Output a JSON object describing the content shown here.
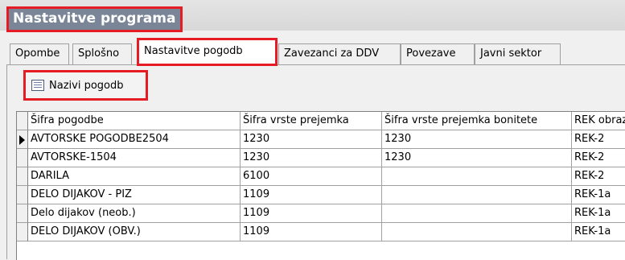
{
  "window": {
    "title": "Nastavitve programa"
  },
  "tabs": [
    {
      "label": "Opombe"
    },
    {
      "label": "Splošno"
    },
    {
      "label": "Nastavitve pogodb",
      "active": true
    },
    {
      "label": "Zavezanci za DDV"
    },
    {
      "label": "Povezave"
    },
    {
      "label": "Javni sektor"
    }
  ],
  "toolbar": {
    "button_label": "Nazivi pogodb",
    "button_icon": "list-icon"
  },
  "grid": {
    "columns": [
      "Šifra pogodbe",
      "Šifra vrste prejemka",
      "Šifra vrste prejemka bonitete",
      "REK obraz"
    ],
    "rows": [
      [
        "AVTORSKE POGODBE2504",
        "1230",
        "1230",
        "REK-2"
      ],
      [
        "AVTORSKE-1504",
        "1230",
        "1230",
        "REK-2"
      ],
      [
        "DARILA",
        "6100",
        "",
        "REK-2"
      ],
      [
        "DELO DIJAKOV - PIZ",
        "1109",
        "",
        "REK-1a"
      ],
      [
        "Delo dijakov (neob.)",
        "1109",
        "",
        "REK-1a"
      ],
      [
        "DELO DIJAKOV (OBV.)",
        "1109",
        "",
        "REK-1a"
      ]
    ],
    "current_row": 0
  },
  "colors": {
    "highlight": "#e51c23",
    "title_bg": "#7a8597"
  }
}
